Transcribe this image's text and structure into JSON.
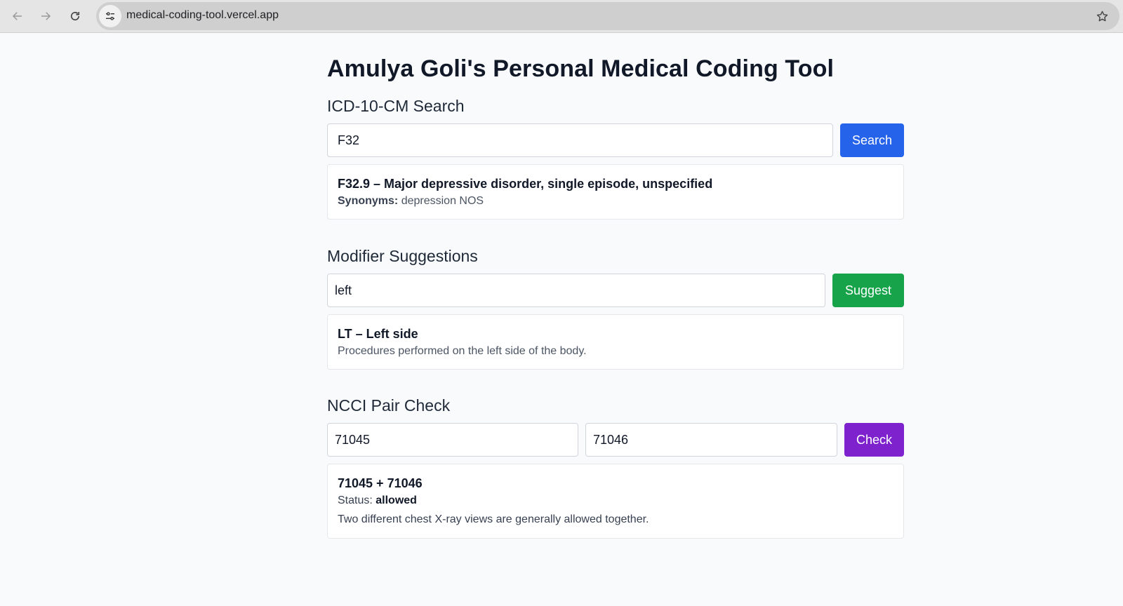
{
  "browser": {
    "url": "medical-coding-tool.vercel.app"
  },
  "page": {
    "title": "Amulya Goli's Personal Medical Coding Tool"
  },
  "icd_search": {
    "heading": "ICD-10-CM Search",
    "input_value": "F32",
    "button_label": "Search",
    "result": {
      "title": "F32.9 – Major depressive disorder, single episode, unspecified",
      "synonyms_label": "Synonyms:",
      "synonyms_value": "depression NOS"
    }
  },
  "modifier": {
    "heading": "Modifier Suggestions",
    "input_value": "left",
    "button_label": "Suggest",
    "result": {
      "title": "LT – Left side",
      "description": "Procedures performed on the left side of the body."
    }
  },
  "ncci": {
    "heading": "NCCI Pair Check",
    "input1_value": "71045",
    "input2_value": "71046",
    "button_label": "Check",
    "result": {
      "title": "71045 + 71046",
      "status_label": "Status:",
      "status_value": "allowed",
      "description": "Two different chest X-ray views are generally allowed together."
    }
  },
  "colors": {
    "search_button": "#2563eb",
    "suggest_button": "#16a34a",
    "check_button": "#7e22ce"
  },
  "icons": {
    "back": "arrow-left-icon",
    "forward": "arrow-right-icon",
    "reload": "reload-icon",
    "site_info": "tune-icon",
    "bookmark": "star-icon"
  }
}
